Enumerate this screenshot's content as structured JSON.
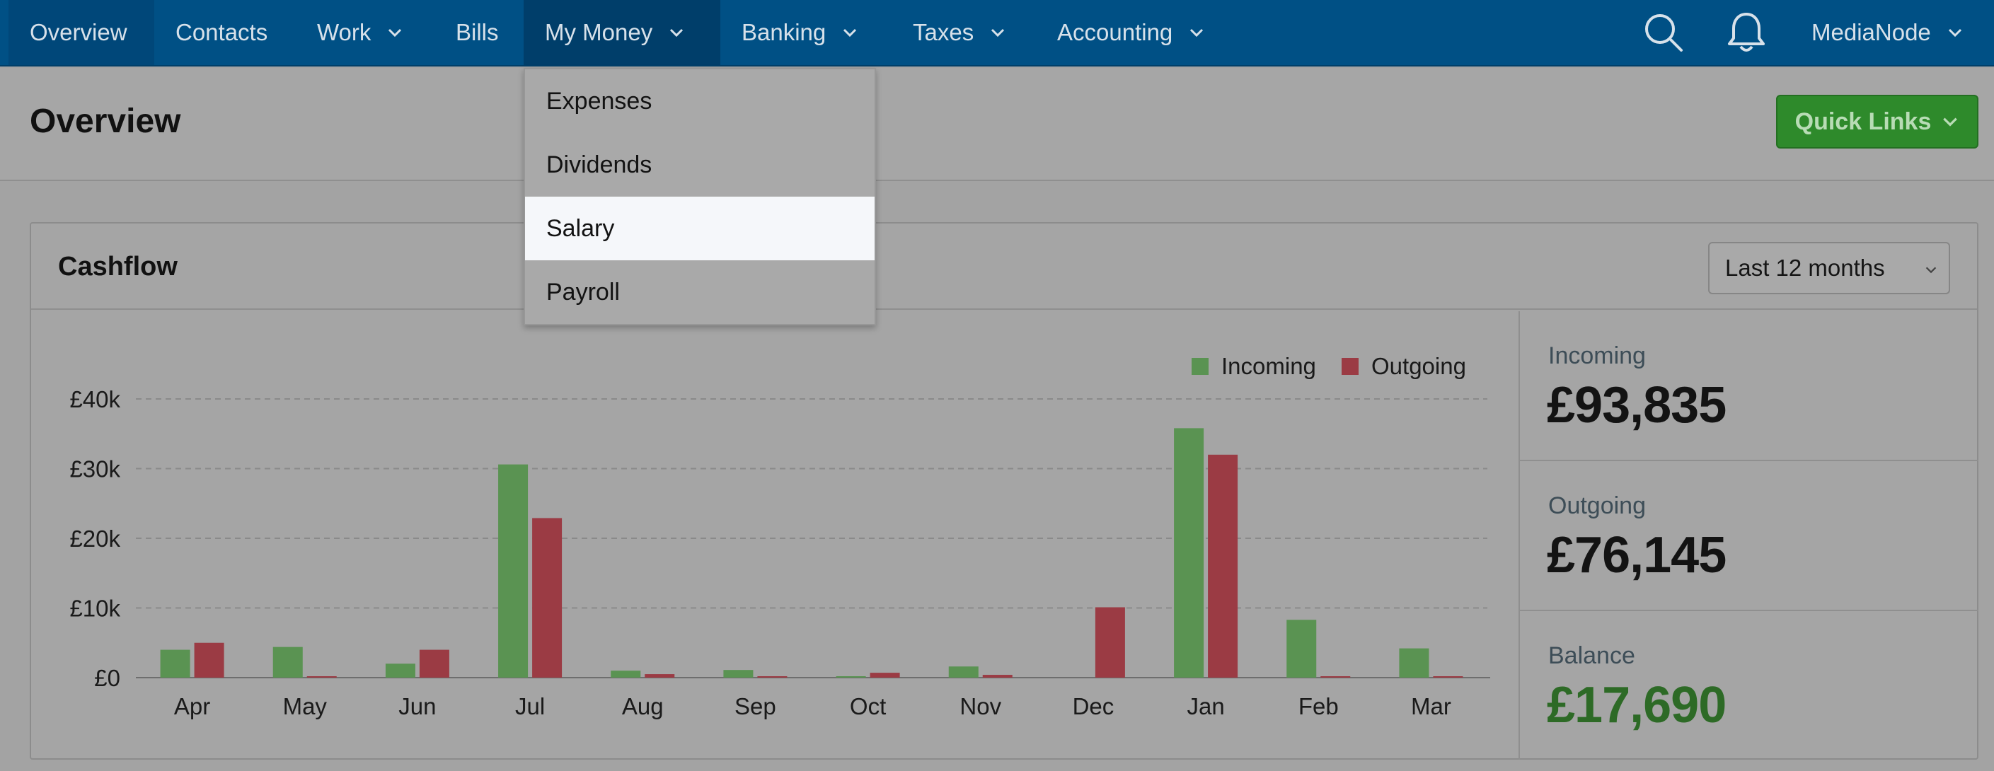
{
  "nav": {
    "items": [
      {
        "label": "Overview"
      },
      {
        "label": "Contacts"
      },
      {
        "label": "Work"
      },
      {
        "label": "Bills"
      },
      {
        "label": "My Money"
      },
      {
        "label": "Banking"
      },
      {
        "label": "Taxes"
      },
      {
        "label": "Accounting"
      }
    ],
    "account_name": "MediaNode",
    "icons": [
      "search-icon",
      "bell-icon"
    ]
  },
  "header": {
    "title": "Overview",
    "quick_links_label": "Quick Links"
  },
  "dropdown": {
    "items": [
      {
        "label": "Expenses"
      },
      {
        "label": "Dividends"
      },
      {
        "label": "Salary",
        "highlighted": true
      },
      {
        "label": "Payroll"
      }
    ]
  },
  "cashflow": {
    "title": "Cashflow",
    "period": "Last 12 months",
    "stats": [
      {
        "label": "Incoming",
        "value": "£93,835"
      },
      {
        "label": "Outgoing",
        "value": "£76,145"
      },
      {
        "label": "Balance",
        "value": "£17,690"
      }
    ]
  },
  "colors": {
    "nav_bg": "#005085",
    "incoming": "#5a9352",
    "outgoing": "#9b3b44",
    "balance": "#2d6a26",
    "quick_links": "#2e8a2b"
  },
  "chart_data": {
    "type": "bar",
    "categories": [
      "Apr",
      "May",
      "Jun",
      "Jul",
      "Aug",
      "Sep",
      "Oct",
      "Nov",
      "Dec",
      "Jan",
      "Feb",
      "Mar"
    ],
    "series": [
      {
        "name": "Incoming",
        "values": [
          4000,
          4400,
          2000,
          30600,
          1000,
          1100,
          100,
          1600,
          0,
          35800,
          8300,
          4200
        ]
      },
      {
        "name": "Outgoing",
        "values": [
          5000,
          200,
          4000,
          22900,
          500,
          200,
          700,
          400,
          10100,
          32000,
          200,
          200
        ]
      }
    ],
    "y_ticks": [
      "£0",
      "£10k",
      "£20k",
      "£30k",
      "£40k"
    ],
    "ylim": [
      0,
      40000
    ],
    "grid": true,
    "legend": "top-right"
  }
}
